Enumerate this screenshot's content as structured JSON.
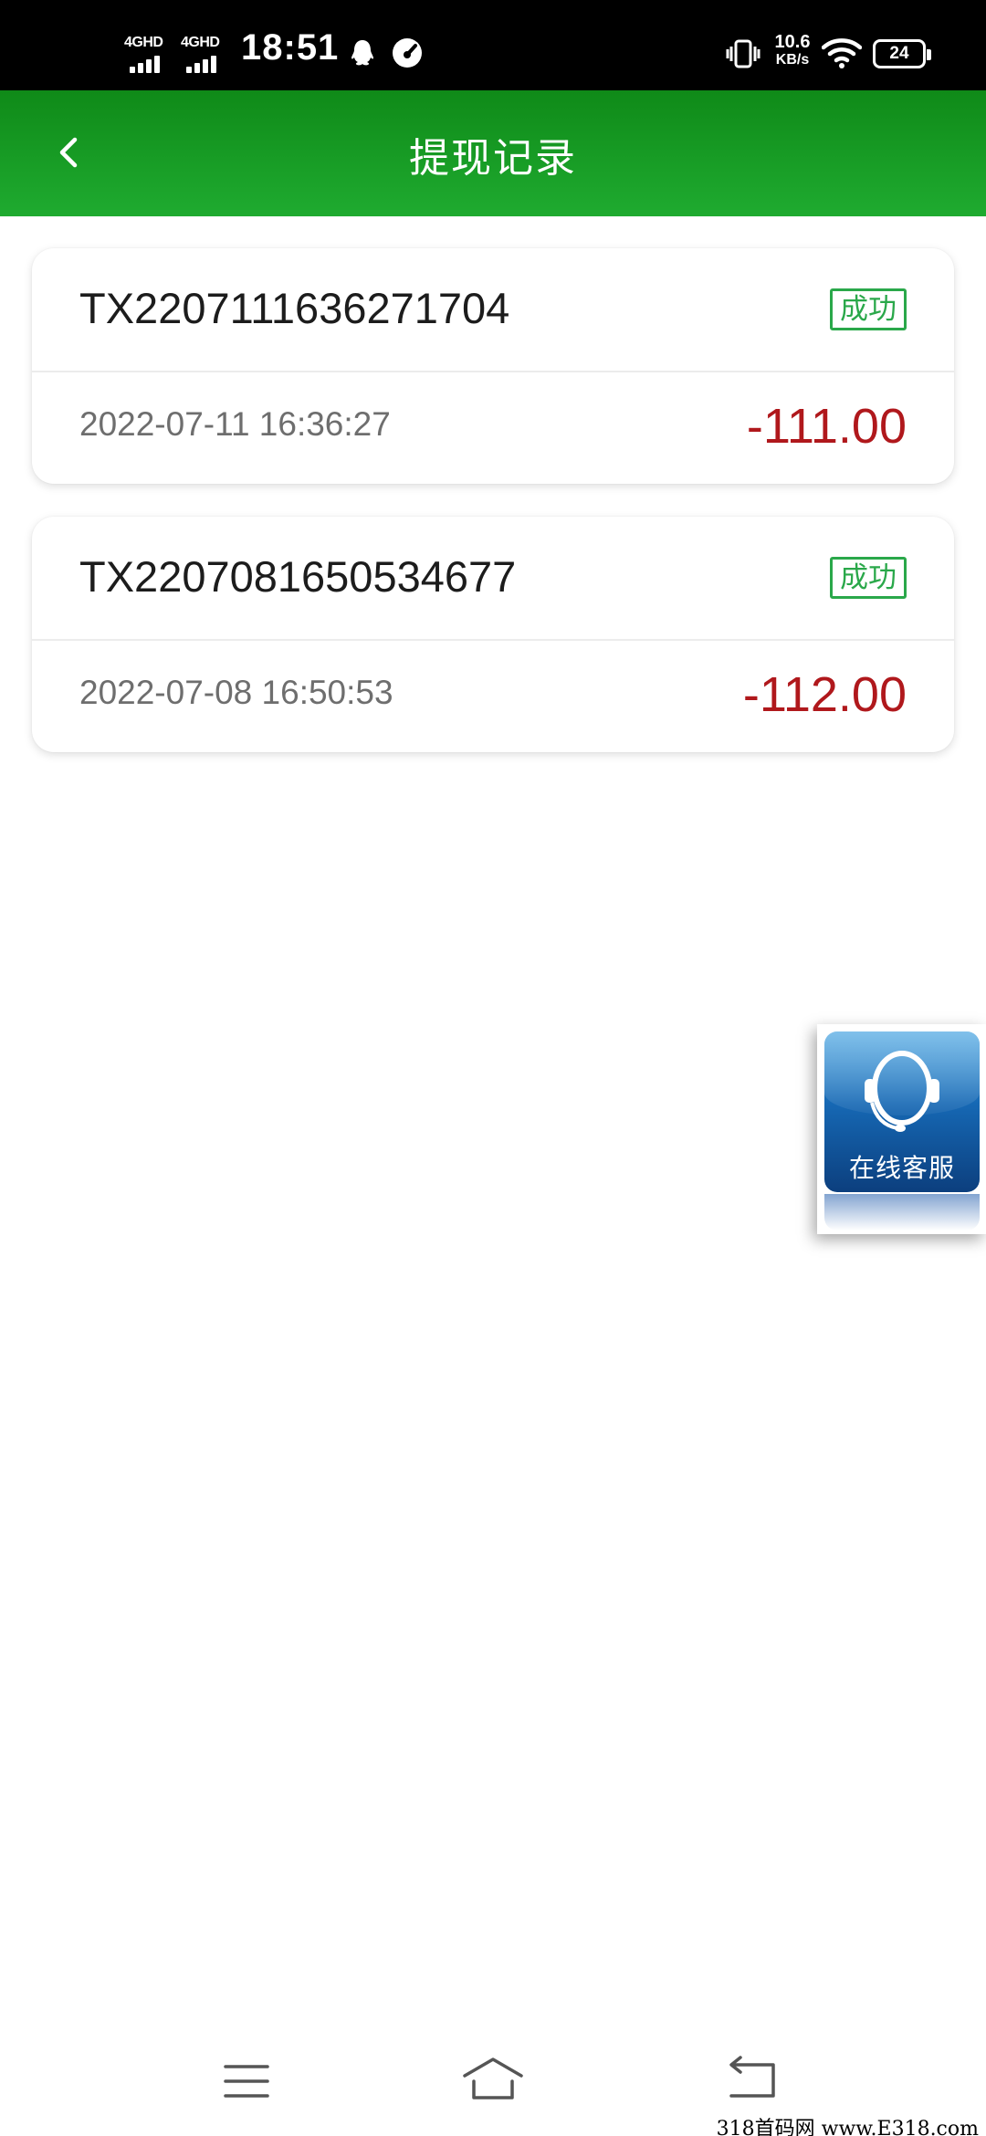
{
  "status_bar": {
    "network_1": "4GHD",
    "network_2": "4GHD",
    "time": "18:51",
    "net_speed_value": "10.6",
    "net_speed_unit": "KB/s",
    "battery_level": "24",
    "icons": [
      "qq-icon",
      "gauge-icon",
      "vibrate-icon",
      "wifi-icon",
      "battery-icon"
    ]
  },
  "header": {
    "title": "提现记录",
    "back_icon": "chevron-left-icon",
    "color_start": "#0f8a18",
    "color_end": "#1fab30"
  },
  "records": [
    {
      "id": "TX2207111636271704",
      "status": "成功",
      "time": "2022-07-11 16:36:27",
      "amount": "-111.00"
    },
    {
      "id": "TX2207081650534677",
      "status": "成功",
      "time": "2022-07-08 16:50:53",
      "amount": "-112.00"
    }
  ],
  "customer_service": {
    "label": "在线客服",
    "icon": "headset-icon"
  },
  "nav_bar": {
    "icons": [
      "menu-icon",
      "home-icon",
      "back-icon"
    ]
  },
  "watermark": "318首码网 www.E318.com",
  "colors": {
    "status_success": "#2aa84a",
    "amount_negative": "#b0181c"
  }
}
